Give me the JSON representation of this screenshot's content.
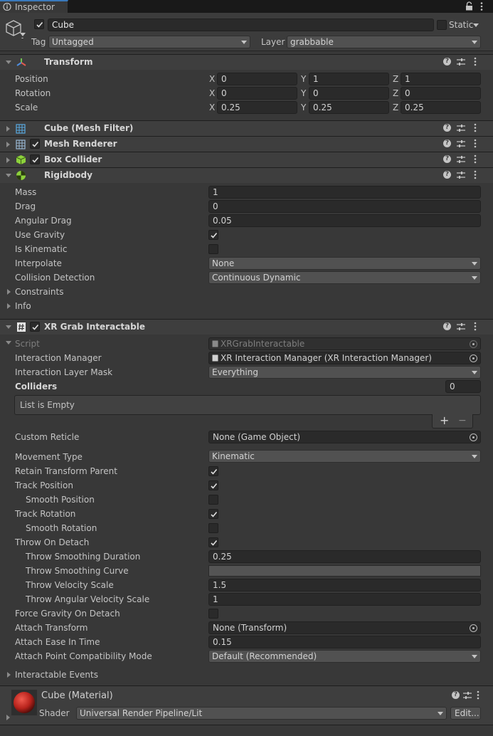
{
  "tab": {
    "title": "Inspector"
  },
  "header": {
    "object_name": "Cube",
    "static_label": "Static",
    "tag_label": "Tag",
    "tag_value": "Untagged",
    "layer_label": "Layer",
    "layer_value": "grabbable"
  },
  "transform": {
    "title": "Transform",
    "position_label": "Position",
    "rotation_label": "Rotation",
    "scale_label": "Scale",
    "axes": [
      "X",
      "Y",
      "Z"
    ],
    "position": [
      "0",
      "1",
      "1"
    ],
    "rotation": [
      "0",
      "0",
      "0"
    ],
    "scale": [
      "0.25",
      "0.25",
      "0.25"
    ]
  },
  "components": {
    "mesh_filter": "Cube (Mesh Filter)",
    "mesh_renderer": "Mesh Renderer",
    "box_collider": "Box Collider"
  },
  "rigidbody": {
    "title": "Rigidbody",
    "mass_label": "Mass",
    "mass": "1",
    "drag_label": "Drag",
    "drag": "0",
    "angular_drag_label": "Angular Drag",
    "angular_drag": "0.05",
    "use_gravity_label": "Use Gravity",
    "is_kinematic_label": "Is Kinematic",
    "interpolate_label": "Interpolate",
    "interpolate": "None",
    "collision_label": "Collision Detection",
    "collision": "Continuous Dynamic",
    "constraints_label": "Constraints",
    "info_label": "Info"
  },
  "xr": {
    "title": "XR Grab Interactable",
    "script_label": "Script",
    "script": "XRGrabInteractable",
    "manager_label": "Interaction Manager",
    "manager": "XR Interaction Manager (XR Interaction Manager)",
    "layer_mask_label": "Interaction Layer Mask",
    "layer_mask": "Everything",
    "colliders_label": "Colliders",
    "colliders_count": "0",
    "list_empty": "List is Empty",
    "plus": "+",
    "minus": "−",
    "reticle_label": "Custom Reticle",
    "reticle": "None (Game Object)",
    "movement_label": "Movement Type",
    "movement": "Kinematic",
    "retain_label": "Retain Transform Parent",
    "track_pos_label": "Track Position",
    "smooth_pos_label": "Smooth Position",
    "track_rot_label": "Track Rotation",
    "smooth_rot_label": "Smooth Rotation",
    "throw_label": "Throw On Detach",
    "tsd_label": "Throw Smoothing Duration",
    "tsd": "0.25",
    "tsc_label": "Throw Smoothing Curve",
    "tvs_label": "Throw Velocity Scale",
    "tvs": "1.5",
    "tavs_label": "Throw Angular Velocity Scale",
    "tavs": "1",
    "force_gravity_label": "Force Gravity On Detach",
    "attach_label": "Attach Transform",
    "attach": "None (Transform)",
    "ease_label": "Attach Ease In Time",
    "ease": "0.15",
    "compat_label": "Attach Point Compatibility Mode",
    "compat": "Default (Recommended)",
    "events_label": "Interactable Events"
  },
  "material": {
    "title": "Cube (Material)",
    "shader_label": "Shader",
    "shader": "Universal Render Pipeline/Lit",
    "edit_label": "Edit..."
  }
}
